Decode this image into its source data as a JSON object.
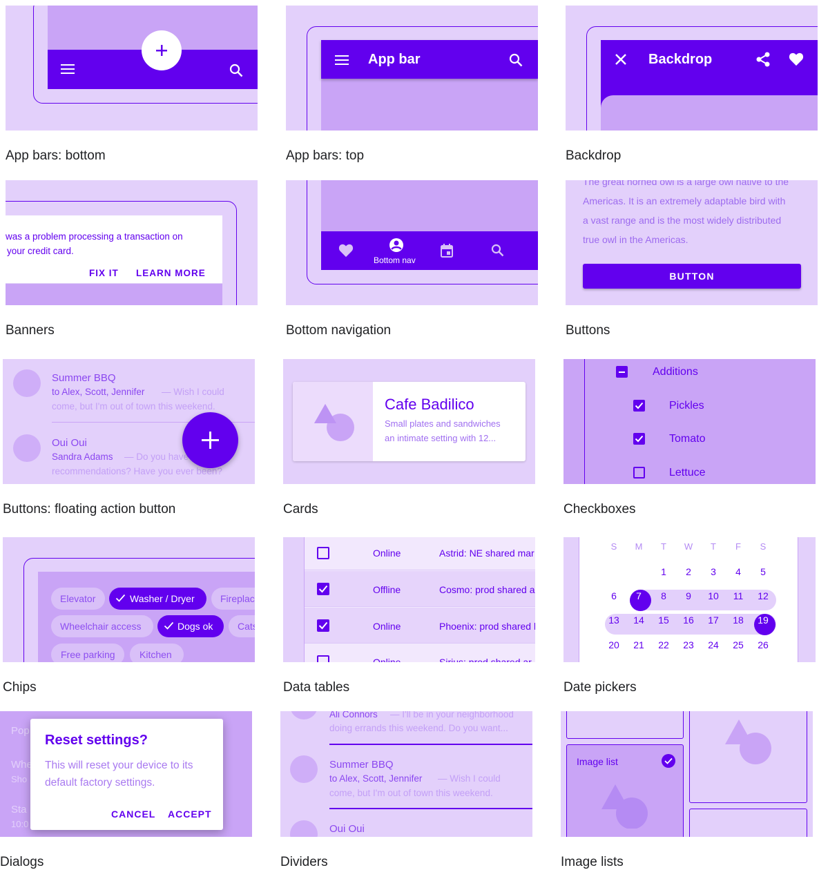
{
  "colors": {
    "primary": "#6200ee",
    "lavender": "#c9a4f6",
    "pale": "#e3d0fb",
    "text": "#202124"
  },
  "captions": [
    "App bars: bottom",
    "App bars: top",
    "Backdrop",
    "Banners",
    "Bottom navigation",
    "Buttons",
    "Buttons: floating action button",
    "Cards",
    "Checkboxes",
    "Chips",
    "Data tables",
    "Date pickers",
    "Dialogs",
    "Dividers",
    "Image lists"
  ],
  "topbar": {
    "title": "App bar"
  },
  "backdrop": {
    "title": "Backdrop"
  },
  "banner": {
    "line1": "was a problem processing a transaction on",
    "line2": "your credit card.",
    "fix": "FIX IT",
    "learn": "LEARN MORE"
  },
  "bottomnav": {
    "label": "Bottom nav"
  },
  "buttons": {
    "t1": "The great horned owl is a large owl native to the",
    "t2": "Americas. It is an extremely adaptable bird with",
    "t3": "a vast range and is the most widely distributed",
    "t4": "true owl in the Americas.",
    "button": "BUTTON"
  },
  "fab": {
    "i1_title": "Summer BBQ",
    "i1_sub": "to Alex, Scott, Jennifer",
    "i1_snip": "— Wish I could",
    "i1_line2": "come, but I'm out of town this weekend.",
    "i2_title": "Oui Oui",
    "i2_sub": "Sandra Adams",
    "i2_snip": "— Do you have",
    "i2_line2": "recommendations? Have you ever been?"
  },
  "cards": {
    "title": "Cafe Badilico",
    "line1": "Small plates and sandwiches",
    "line2": "an intimate setting with 12..."
  },
  "checkboxes": {
    "parent": "Additions",
    "items": [
      "Pickles",
      "Tomato",
      "Lettuce"
    ]
  },
  "chips": {
    "row1": [
      "Elevator",
      "Washer / Dryer",
      "Fireplac"
    ],
    "row2": [
      "Wheelchair access",
      "Dogs ok",
      "Cats"
    ],
    "row3": [
      "Free parking",
      "Kitchen"
    ]
  },
  "datatable": {
    "rows": [
      {
        "status": "Online",
        "name": "Astrid: NE shared mar"
      },
      {
        "status": "Offline",
        "name": "Cosmo: prod shared a"
      },
      {
        "status": "Online",
        "name": "Phoenix: prod shared l"
      },
      {
        "status": "Online",
        "name": "Sirius: prod shared ar"
      }
    ]
  },
  "datepicker": {
    "days": [
      "S",
      "M",
      "T",
      "W",
      "T",
      "F",
      "S"
    ],
    "week1": [
      "1",
      "2",
      "3",
      "4",
      "5"
    ],
    "week2": [
      "6",
      "7",
      "8",
      "9",
      "10",
      "11",
      "12"
    ],
    "week3": [
      "13",
      "14",
      "15",
      "16",
      "17",
      "18",
      "19"
    ],
    "week4": [
      "20",
      "21",
      "22",
      "23",
      "24",
      "25",
      "26"
    ]
  },
  "dialog": {
    "title": "Reset settings?",
    "body1": "This will reset your device to its",
    "body2": "default factory settings.",
    "cancel": "CANCEL",
    "accept": "ACCEPT",
    "bg1": "Pop",
    "bg2": "Whe",
    "bg3": "Sho",
    "bg4": "Sta",
    "bg5": "10:0"
  },
  "dividers": {
    "top_sender": "Ali Connors",
    "top_snip": "— I'll be in your neighborhood",
    "top_line2": "doing errands this weekend. Do you want...",
    "i1_title": "Summer BBQ",
    "i1_sub": "to Alex, Scott, Jennifer",
    "i1_snip": "— Wish I could",
    "i1_line2": "come, but I'm out of town this weekend.",
    "i2_title": "Oui Oui"
  },
  "imagelist": {
    "label": "Image list"
  }
}
